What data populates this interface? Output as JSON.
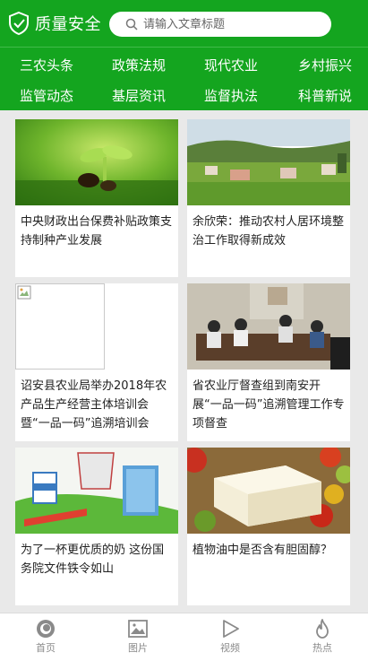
{
  "header": {
    "site_name": "质量安全",
    "logo_icon": "shield-check-icon"
  },
  "search": {
    "placeholder": "请输入文章标题",
    "value": ""
  },
  "nav": {
    "row1": [
      "三农头条",
      "政策法规",
      "现代农业",
      "乡村振兴"
    ],
    "row2": [
      "监管动态",
      "基层资讯",
      "监督执法",
      "科普新说"
    ]
  },
  "articles": [
    {
      "title": "中央财政出台保费补贴政策支持制种产业发展",
      "image": "seedling-photo"
    },
    {
      "title": "余欣荣：推动农村人居环境整治工作取得新成效",
      "image": "village-photo"
    },
    {
      "title": "诏安县农业局举办2018年农产品生产经营主体培训会暨“一品一码”追溯培训会",
      "image": "broken-image"
    },
    {
      "title": "省农业厅督查组到南安开展“一品一码”追溯管理工作专项督查",
      "image": "meeting-photo"
    },
    {
      "title": "为了一杯更优质的奶 这份国务院文件铁令如山",
      "image": "milk-illustration"
    },
    {
      "title": "植物油中是否含有胆固醇？",
      "image": "tofu-photo"
    }
  ],
  "tabbar": [
    {
      "label": "首页",
      "icon": "home-icon"
    },
    {
      "label": "图片",
      "icon": "image-icon"
    },
    {
      "label": "视频",
      "icon": "play-icon"
    },
    {
      "label": "热点",
      "icon": "flame-icon"
    }
  ],
  "colors": {
    "brand": "#14a51f",
    "background": "#e9e9e9",
    "tab_label": "#8a8a8a"
  }
}
